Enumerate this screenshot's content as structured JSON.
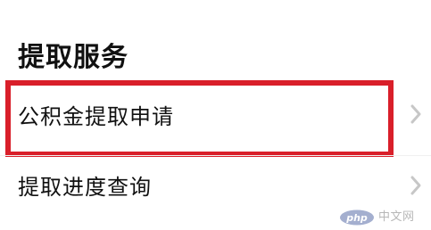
{
  "section": {
    "title": "提取服务"
  },
  "menu": {
    "items": [
      {
        "label": "公积金提取申请",
        "icon": "chevron-right-icon",
        "highlighted": true
      },
      {
        "label": "提取进度查询",
        "icon": "chevron-right-icon",
        "highlighted": false
      }
    ]
  },
  "watermark": {
    "logo": "php",
    "text": "中文网"
  },
  "colors": {
    "highlight": "#d91f2a",
    "chevron": "#c7c7c7",
    "text": "#111111",
    "watermark_logo": "#5a6ea8"
  }
}
